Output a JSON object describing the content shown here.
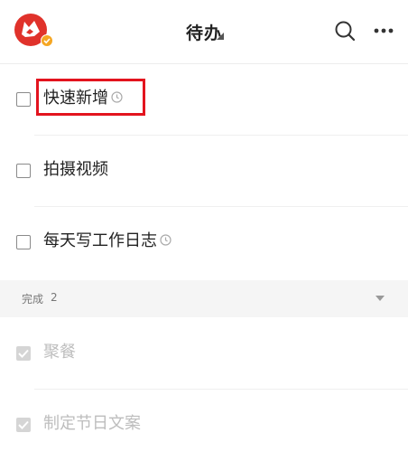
{
  "header": {
    "title": "待办",
    "avatar_icon": "fox-avatar-icon",
    "badge_icon": "verified-check-badge-icon",
    "caret_icon": "dropdown-triangle-icon",
    "search_icon": "search-icon",
    "more_icon": "more-dots-icon"
  },
  "todos": [
    {
      "label": "快速新增",
      "has_reminder": true,
      "checked": false
    },
    {
      "label": "拍摄视频",
      "has_reminder": false,
      "checked": false
    },
    {
      "label": "每天写工作日志",
      "has_reminder": true,
      "checked": false
    }
  ],
  "completed_section": {
    "label": "完成",
    "count": "2",
    "toggle_icon": "collapse-triangle-icon"
  },
  "completed": [
    {
      "label": "聚餐",
      "checked": true
    },
    {
      "label": "制定节日文案",
      "checked": true
    }
  ],
  "colors": {
    "accent_red": "#e3141e",
    "avatar_red": "#e0322b",
    "badge_orange": "#f5a623",
    "section_bg": "#f5f5f5",
    "done_text": "#bdbdbd"
  }
}
